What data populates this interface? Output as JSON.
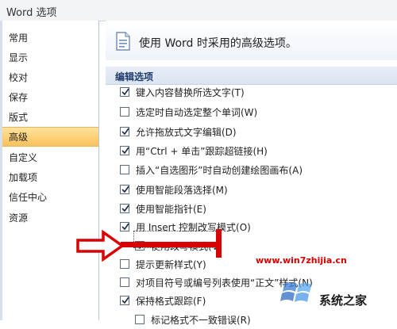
{
  "window": {
    "title": "Word 选项"
  },
  "sidebar": {
    "items": [
      {
        "label": "常用",
        "selected": false
      },
      {
        "label": "显示",
        "selected": false
      },
      {
        "label": "校对",
        "selected": false
      },
      {
        "label": "保存",
        "selected": false
      },
      {
        "label": "版式",
        "selected": false
      },
      {
        "label": "高级",
        "selected": true
      },
      {
        "label": "自定义",
        "selected": false
      },
      {
        "label": "加载项",
        "selected": false
      },
      {
        "label": "信任中心",
        "selected": false
      },
      {
        "label": "资源",
        "selected": false
      }
    ]
  },
  "main": {
    "header": "使用 Word 时采用的高级选项。",
    "section_title": "编辑选项",
    "options": [
      {
        "label": "键入内容替换所选文字(T)",
        "checked": true
      },
      {
        "label": "选定时自动选定整个单词(W)",
        "checked": false
      },
      {
        "label": "允许拖放式文字编辑(D)",
        "checked": true
      },
      {
        "label": "用“Ctrl + 单击”跟踪超链接(H)",
        "checked": true
      },
      {
        "label": "插入“自选图形”时自动创建绘图画布(A)",
        "checked": false
      },
      {
        "label": "使用智能段落选择(M)",
        "checked": true
      },
      {
        "label": "使用智能指针(E)",
        "checked": true
      },
      {
        "label": "用 Insert 控制改写模式(O)",
        "checked": true
      },
      {
        "label": "使用改写模式(V)",
        "checked": true
      },
      {
        "label": "提示更新样式(Y)",
        "checked": false
      },
      {
        "label": "对项目符号或编号列表使用“正文”样式(N)",
        "checked": false
      },
      {
        "label": "保持格式跟踪(F)",
        "checked": true
      },
      {
        "label": "标记格式不一致错误(R)",
        "checked": false
      }
    ]
  },
  "watermark": {
    "url": "www.win7zhijia.cn",
    "brand": "系统之家"
  },
  "colors": {
    "selected_bg": "#ffd27a",
    "annotation_red": "#d90000",
    "section_text": "#1e3d6c"
  }
}
